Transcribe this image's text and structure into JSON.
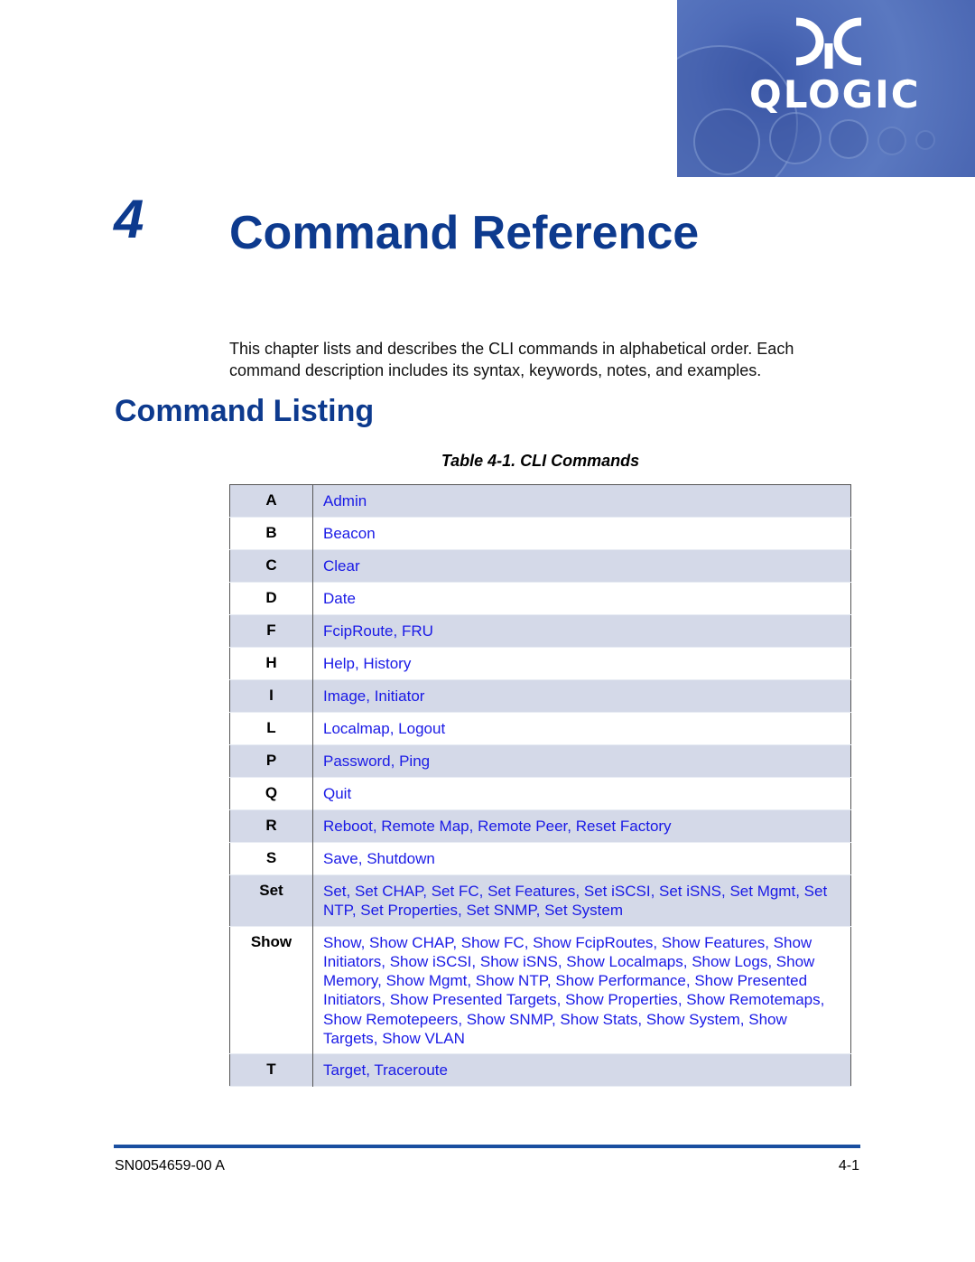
{
  "header": {
    "logo_text": "QLOGIC",
    "logo_reg": "®",
    "logo_icon": "qlogic-mark-icon"
  },
  "chapter": {
    "number": "4",
    "title": "Command Reference"
  },
  "intro": "This chapter lists and describes the CLI commands in alphabetical order. Each command description includes its syntax, keywords, notes, and examples.",
  "section": {
    "title": "Command Listing"
  },
  "table": {
    "caption": "Table 4-1. CLI Commands",
    "rows": [
      {
        "letter": "A",
        "commands": [
          "Admin"
        ]
      },
      {
        "letter": "B",
        "commands": [
          "Beacon"
        ]
      },
      {
        "letter": "C",
        "commands": [
          "Clear"
        ]
      },
      {
        "letter": "D",
        "commands": [
          "Date"
        ]
      },
      {
        "letter": "F",
        "commands": [
          "FcipRoute",
          "FRU"
        ]
      },
      {
        "letter": "H",
        "commands": [
          "Help",
          "History"
        ]
      },
      {
        "letter": "I",
        "commands": [
          "Image",
          "Initiator"
        ]
      },
      {
        "letter": "L",
        "commands": [
          "Localmap",
          "Logout"
        ]
      },
      {
        "letter": "P",
        "commands": [
          "Password",
          "Ping"
        ]
      },
      {
        "letter": "Q",
        "commands": [
          "Quit"
        ]
      },
      {
        "letter": "R",
        "commands": [
          "Reboot",
          "Remote Map",
          "Remote Peer",
          "Reset Factory"
        ]
      },
      {
        "letter": "S",
        "commands": [
          "Save",
          "Shutdown"
        ]
      },
      {
        "letter": "Set",
        "commands": [
          "Set",
          "Set CHAP",
          "Set FC",
          "Set Features",
          "Set iSCSI",
          "Set iSNS",
          "Set Mgmt",
          "Set NTP",
          "Set Properties",
          "Set SNMP",
          "Set System"
        ]
      },
      {
        "letter": "Show",
        "commands": [
          "Show",
          "Show CHAP",
          "Show FC",
          "Show FcipRoutes",
          "Show Features",
          "Show Initiators",
          "Show iSCSI",
          "Show iSNS",
          "Show Localmaps",
          "Show Logs",
          "Show Memory",
          "Show Mgmt",
          "Show NTP",
          "Show Performance",
          "Show Presented Initiators",
          "Show Presented Targets",
          "Show Properties",
          "Show Remotemaps",
          "Show Remotepeers",
          "Show SNMP",
          "Show Stats",
          "Show System",
          "Show Targets",
          "Show VLAN"
        ]
      },
      {
        "letter": "T",
        "commands": [
          "Target",
          "Traceroute"
        ]
      }
    ]
  },
  "footer": {
    "doc_id": "SN0054659-00 A",
    "page": "4-1"
  },
  "colors": {
    "heading": "#0d3a8e",
    "link": "#1a1ae6",
    "row_shade": "#d4d9e8",
    "footer_rule": "#1a4fa0",
    "logo_bg": "#4e6bb8"
  }
}
